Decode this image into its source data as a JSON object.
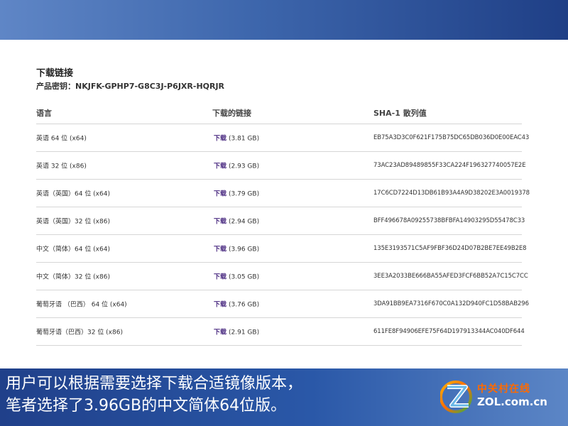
{
  "download": {
    "title": "下载链接",
    "product_key": "产品密钥：NKJFK-GPHP7-G8C3J-P6JXR-HQRJR"
  },
  "table": {
    "headers": [
      "语言",
      "下载的链接",
      "SHA-1 散列值"
    ],
    "rows": [
      {
        "language": "英语 64 位 (x64)",
        "link": "下载",
        "size": "(3.81 GB)",
        "sha1": "EB75A3D3C0F621F175B75DC65DB036D0E00EAC43"
      },
      {
        "language": "英语 32 位 (x86)",
        "link": "下载",
        "size": "(2.93 GB)",
        "sha1": "73AC23AD89489855F33CA224F196327740057E2E"
      },
      {
        "language": "英语（英国）64 位 (x64)",
        "link": "下载",
        "size": "(3.79 GB)",
        "sha1": "17C6CD7224D13DB61B93A4A9D38202E3A0019378"
      },
      {
        "language": "英语（英国）32 位 (x86)",
        "link": "下载",
        "size": "(2.94 GB)",
        "sha1": "BFF496678A09255738BFBFA14903295D55478C33"
      },
      {
        "language": "中文（简体）64 位 (x64)",
        "link": "下载",
        "size": "(3.96 GB)",
        "sha1": "135E3193571C5AF9FBF36D24D07B2BE7EE49B2E8"
      },
      {
        "language": "中文（简体）32 位 (x86)",
        "link": "下载",
        "size": "(3.05 GB)",
        "sha1": "3EE3A2033BE666BA55AFED3FCF6BB52A7C15C7CC"
      },
      {
        "language": "葡萄牙语 （巴西） 64 位 (x64)",
        "link": "下载",
        "size": "(3.76 GB)",
        "sha1": "3DA91BB9EA7316F670C0A132D940FC1D58BAB296"
      },
      {
        "language": "葡萄牙语（巴西）32 位 (x86)",
        "link": "下载",
        "size": "(2.91 GB)",
        "sha1": "611FE8F94906EFE75F64D197913344AC040DF644"
      }
    ]
  },
  "caption": {
    "line1": "用户可以根据需要选择下载合适镜像版本，",
    "line2": "笔者选择了3.96GB的中文简体64位版。"
  },
  "logo": {
    "cn": "中关村在线",
    "en": "ZOL.com.cn"
  },
  "colors": {
    "link": "#4c2d82",
    "banner_dark": "#20408a",
    "banner_light": "#5c86c6",
    "logo_orange": "#ff6a00"
  }
}
